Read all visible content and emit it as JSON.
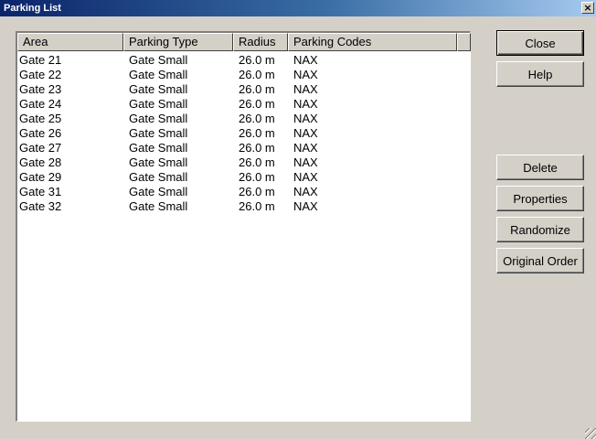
{
  "window": {
    "title": "Parking List",
    "close_glyph": "×"
  },
  "table": {
    "columns": [
      "Area",
      "Parking Type",
      "Radius",
      "Parking Codes"
    ],
    "rows": [
      [
        "Gate  21",
        "Gate Small",
        "26.0 m",
        "NAX"
      ],
      [
        "Gate  22",
        "Gate Small",
        "26.0 m",
        "NAX"
      ],
      [
        "Gate  23",
        "Gate Small",
        "26.0 m",
        "NAX"
      ],
      [
        "Gate  24",
        "Gate Small",
        "26.0 m",
        "NAX"
      ],
      [
        "Gate  25",
        "Gate Small",
        "26.0 m",
        "NAX"
      ],
      [
        "Gate  26",
        "Gate Small",
        "26.0 m",
        "NAX"
      ],
      [
        "Gate  27",
        "Gate Small",
        "26.0 m",
        "NAX"
      ],
      [
        "Gate  28",
        "Gate Small",
        "26.0 m",
        "NAX"
      ],
      [
        "Gate  29",
        "Gate Small",
        "26.0 m",
        "NAX"
      ],
      [
        "Gate  31",
        "Gate Small",
        "26.0 m",
        "NAX"
      ],
      [
        "Gate  32",
        "Gate Small",
        "26.0 m",
        "NAX"
      ]
    ]
  },
  "buttons": {
    "close": "Close",
    "help": "Help",
    "delete": "Delete",
    "properties": "Properties",
    "randomize": "Randomize",
    "original_order": "Original Order"
  }
}
